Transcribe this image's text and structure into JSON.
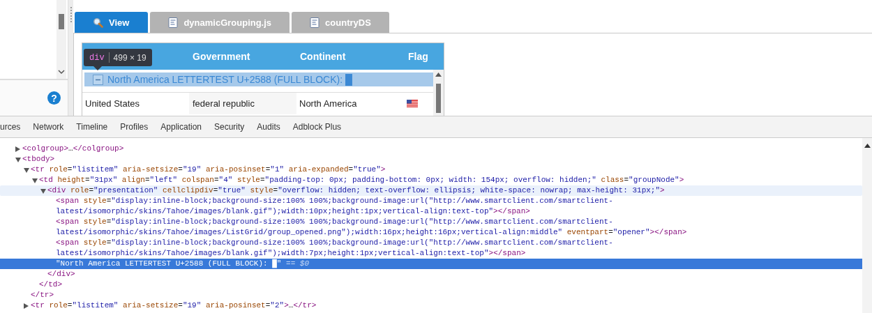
{
  "left_panel": {
    "help_glyph": "?"
  },
  "app_tabs": [
    {
      "label": "View",
      "kind": "search",
      "selected": true
    },
    {
      "label": "dynamicGrouping.js",
      "kind": "file",
      "selected": false
    },
    {
      "label": "countryDS",
      "kind": "file",
      "selected": false
    }
  ],
  "grid": {
    "header_labels": [
      "Government",
      "Continent",
      "Flag"
    ],
    "inspect_tooltip": {
      "tag": "div",
      "size": "499 × 19"
    },
    "group": {
      "label": "North America LETTERTEST U+2588 (FULL BLOCK): █",
      "expanded": true
    },
    "rows": [
      {
        "cells": [
          "United States",
          "federal republic",
          "North America"
        ]
      }
    ]
  },
  "devtools_tabs": [
    {
      "label": "urces",
      "selected": false
    },
    {
      "label": "Network",
      "selected": false
    },
    {
      "label": "Timeline",
      "selected": false
    },
    {
      "label": "Profiles",
      "selected": false
    },
    {
      "label": "Application",
      "selected": false
    },
    {
      "label": "Security",
      "selected": false
    },
    {
      "label": "Audits",
      "selected": false
    },
    {
      "label": "Adblock Plus",
      "selected": false
    }
  ],
  "dom_tree": [
    {
      "kind": "collapsible",
      "markup": "<colgroup>…</colgroup>",
      "expanded": false,
      "selected": false,
      "hovered": false
    },
    {
      "kind": "collapsible",
      "markup": "<tbody>",
      "expanded": true,
      "selected": false,
      "hovered": false,
      "children": [
        {
          "kind": "collapsible",
          "markup": "<tr role=\"listitem\" aria-setsize=\"19\" aria-posinset=\"1\" aria-expanded=\"true\">",
          "expanded": true,
          "selected": false,
          "hovered": false,
          "closing": "</tr>",
          "children": [
            {
              "kind": "collapsible",
              "markup": "<td height=\"31px\" align=\"left\" colspan=\"4\" style=\"padding-top: 0px; padding-bottom: 0px; width: 154px; overflow: hidden;\" class=\"groupNode\">",
              "expanded": true,
              "selected": false,
              "hovered": false,
              "closing": "</td>",
              "children": [
                {
                  "kind": "collapsible",
                  "markup": "<div role=\"presentation\" cellclipdiv=\"true\" style=\"overflow: hidden; text-overflow: ellipsis; white-space: nowrap; max-height: 31px;\">",
                  "expanded": true,
                  "selected": false,
                  "hovered": true,
                  "closing": "</div>",
                  "children": [
                    {
                      "kind": "leaf",
                      "markup": "<span style=\"display:inline-block;background-size:100% 100%;background-image:url(\"http://www.smartclient.com/smartclient-latest/isomorphic/skins/Tahoe/images/blank.gif\");width:10px;height:1px;vertical-align:text-top\"></span>",
                      "selected": false,
                      "hovered": false
                    },
                    {
                      "kind": "leaf",
                      "markup": "<span style=\"display:inline-block;background-size:100% 100%;background-image:url(\"http://www.smartclient.com/smartclient-latest/isomorphic/skins/Tahoe/images/ListGrid/group_opened.png\");width:16px;height:16px;vertical-align:middle\" eventpart=\"opener\"></span>",
                      "selected": false,
                      "hovered": false
                    },
                    {
                      "kind": "leaf",
                      "markup": "<span style=\"display:inline-block;background-size:100% 100%;background-image:url(\"http://www.smartclient.com/smartclient-latest/isomorphic/skins/Tahoe/images/blank.gif\");width:7px;height:1px;vertical-align:text-top\"></span>",
                      "selected": false,
                      "hovered": false
                    },
                    {
                      "kind": "text",
                      "markup": "\"North America LETTERTEST U+2588 (FULL BLOCK): █\"",
                      "console_ref": "== $0",
                      "selected": true,
                      "hovered": false
                    }
                  ]
                }
              ]
            }
          ]
        },
        {
          "kind": "collapsible",
          "markup": "<tr role=\"listitem\" aria-setsize=\"19\" aria-posinset=\"2\">…</tr>",
          "expanded": false,
          "selected": false,
          "hovered": false
        }
      ]
    }
  ]
}
